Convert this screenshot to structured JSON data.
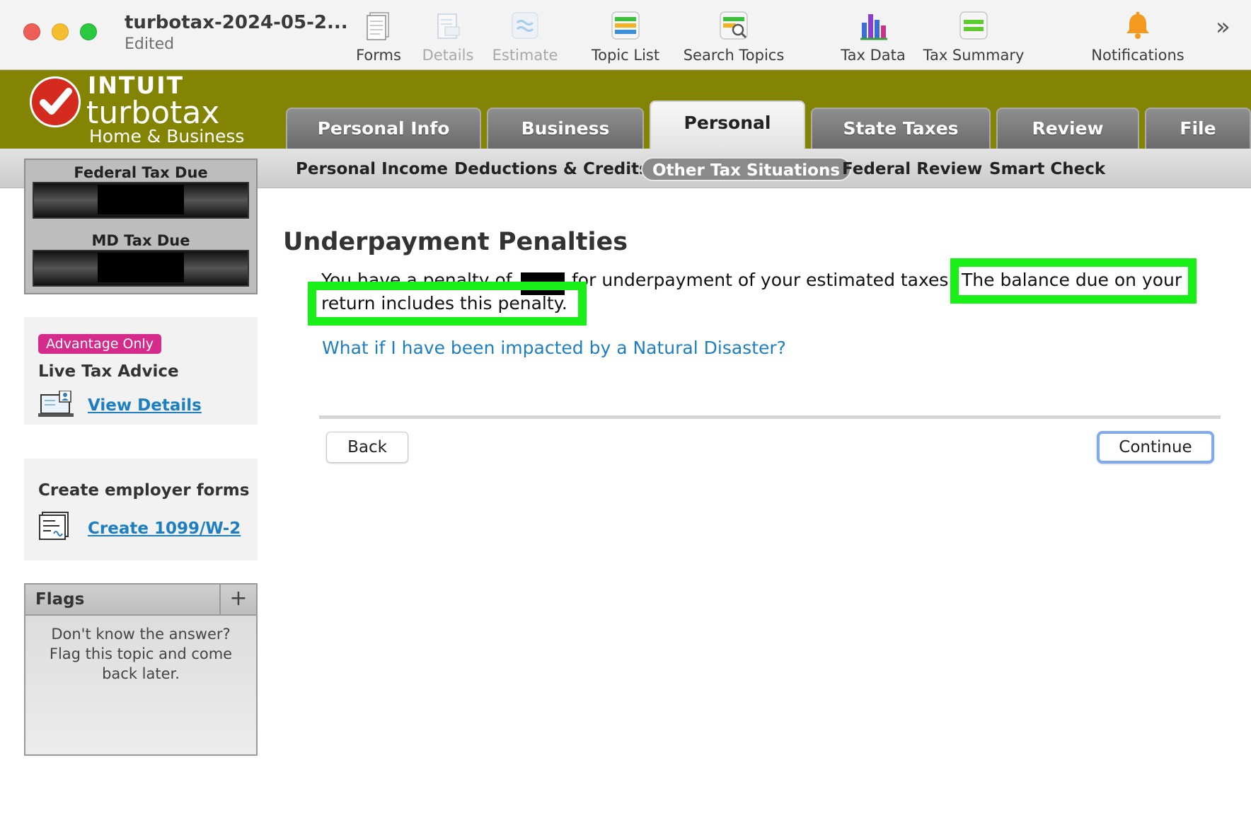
{
  "window": {
    "doc_title": "turbotax-2024-05-2...",
    "doc_status": "Edited"
  },
  "toolbar": {
    "items": [
      {
        "label": "Forms",
        "icon": "forms-icon",
        "enabled": true
      },
      {
        "label": "Details",
        "icon": "details-icon",
        "enabled": false
      },
      {
        "label": "Estimate",
        "icon": "estimate-icon",
        "enabled": false
      },
      {
        "label": "Topic List",
        "icon": "topic-list-icon",
        "enabled": true
      },
      {
        "label": "Search Topics",
        "icon": "search-topics-icon",
        "enabled": true
      },
      {
        "label": "Tax Data",
        "icon": "bar-chart-icon",
        "enabled": true
      },
      {
        "label": "Tax Summary",
        "icon": "tax-summary-icon",
        "enabled": true
      },
      {
        "label": "Notifications",
        "icon": "bell-icon",
        "enabled": true
      }
    ],
    "more_symbol": "»"
  },
  "brand": {
    "company": "INTUIT",
    "product": "turbotax",
    "edition": "Home & Business",
    "colors": {
      "bar": "#838404",
      "check": "#d52b1e"
    }
  },
  "main_tabs": [
    {
      "label": "Personal Info",
      "active": false
    },
    {
      "label": "Business",
      "active": false
    },
    {
      "label": "Personal",
      "active": true
    },
    {
      "label": "State Taxes",
      "active": false
    },
    {
      "label": "Review",
      "active": false
    },
    {
      "label": "File",
      "active": false
    }
  ],
  "sub_tabs": [
    {
      "label": "Personal Income",
      "active": false
    },
    {
      "label": "Deductions & Credits",
      "active": false
    },
    {
      "label": "Other Tax Situations",
      "active": true
    },
    {
      "label": "Federal Review",
      "active": false
    },
    {
      "label": "Smart Check",
      "active": false
    }
  ],
  "sidebar": {
    "federal_due_label": "Federal Tax Due",
    "md_due_label": "MD Tax Due",
    "advice": {
      "badge": "Advantage Only",
      "title": "Live Tax Advice",
      "link": "View Details",
      "badge_color": "#d52b8a"
    },
    "employer": {
      "title": "Create employer forms",
      "link": "Create 1099/W-2"
    },
    "flags": {
      "title": "Flags",
      "add": "+",
      "text": "Don't know the answer? Flag this topic and come back later."
    }
  },
  "content": {
    "title": "Underpayment Penalties",
    "penalty_prefix": "You have a penalty of",
    "penalty_suffix": "for underpayment of your estimated taxes.",
    "highlight_part1": "The balance due on your",
    "highlight_part2": "return includes this penalty.",
    "highlight_color": "#18f018",
    "disaster_link": "What if I have been impacted by a Natural Disaster?",
    "back_button": "Back",
    "continue_button": "Continue"
  }
}
